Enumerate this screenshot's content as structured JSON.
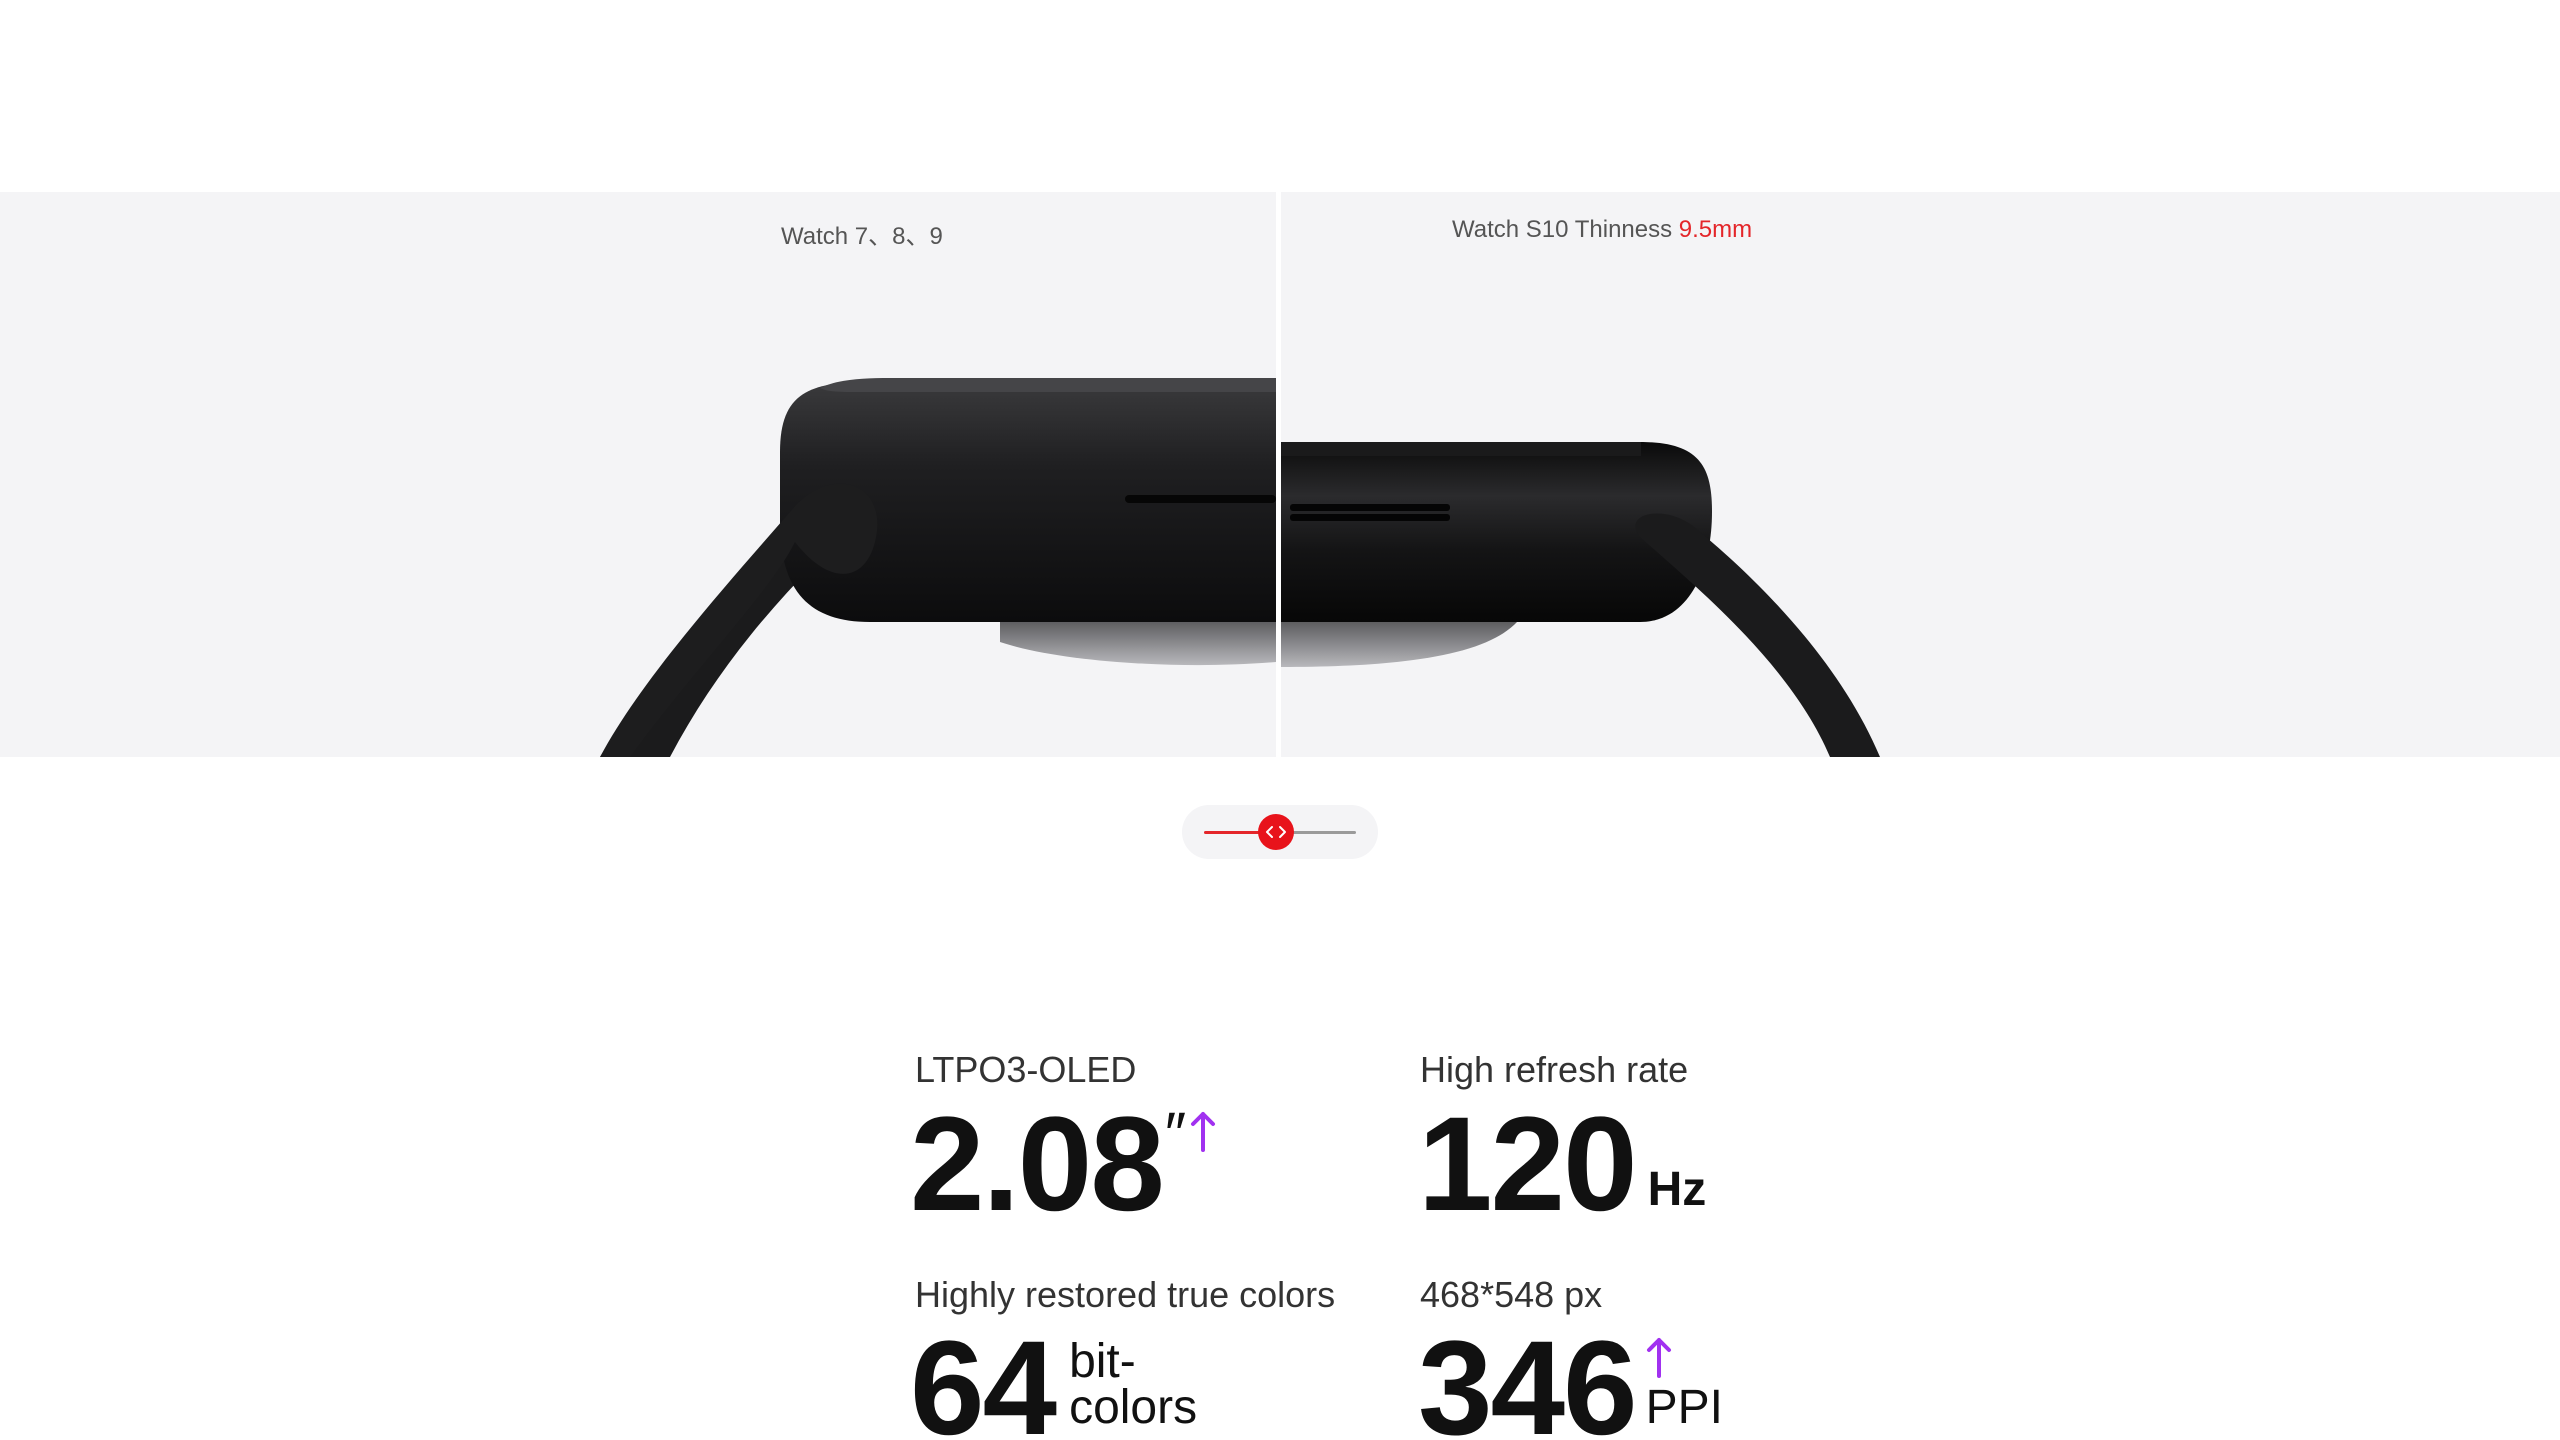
{
  "comparison": {
    "left_caption": "Watch 7、8、9",
    "right_caption_prefix": "Watch S10 Thinness ",
    "right_caption_value": "9.5mm",
    "accent_color": "#e4262a"
  },
  "slider": {
    "handle_icon": "chevron-left-right-icon",
    "position": 0.5
  },
  "specs": [
    {
      "label": "LTPO3-OLED",
      "value": "2.08",
      "unit": "″",
      "has_arrow": true
    },
    {
      "label": "High refresh rate",
      "value": "120",
      "unit": "Hz",
      "has_arrow": false
    },
    {
      "label": "Highly restored true colors",
      "value": "64",
      "unit_line1": "bit-",
      "unit_line2": "colors",
      "has_arrow": false
    },
    {
      "label": "468*548 px",
      "value": "346",
      "unit": "PPI",
      "has_arrow": true
    }
  ],
  "colors": {
    "arrow": "#a131f0",
    "slider_knob": "#e8131b",
    "panel_bg": "#f4f4f6"
  }
}
